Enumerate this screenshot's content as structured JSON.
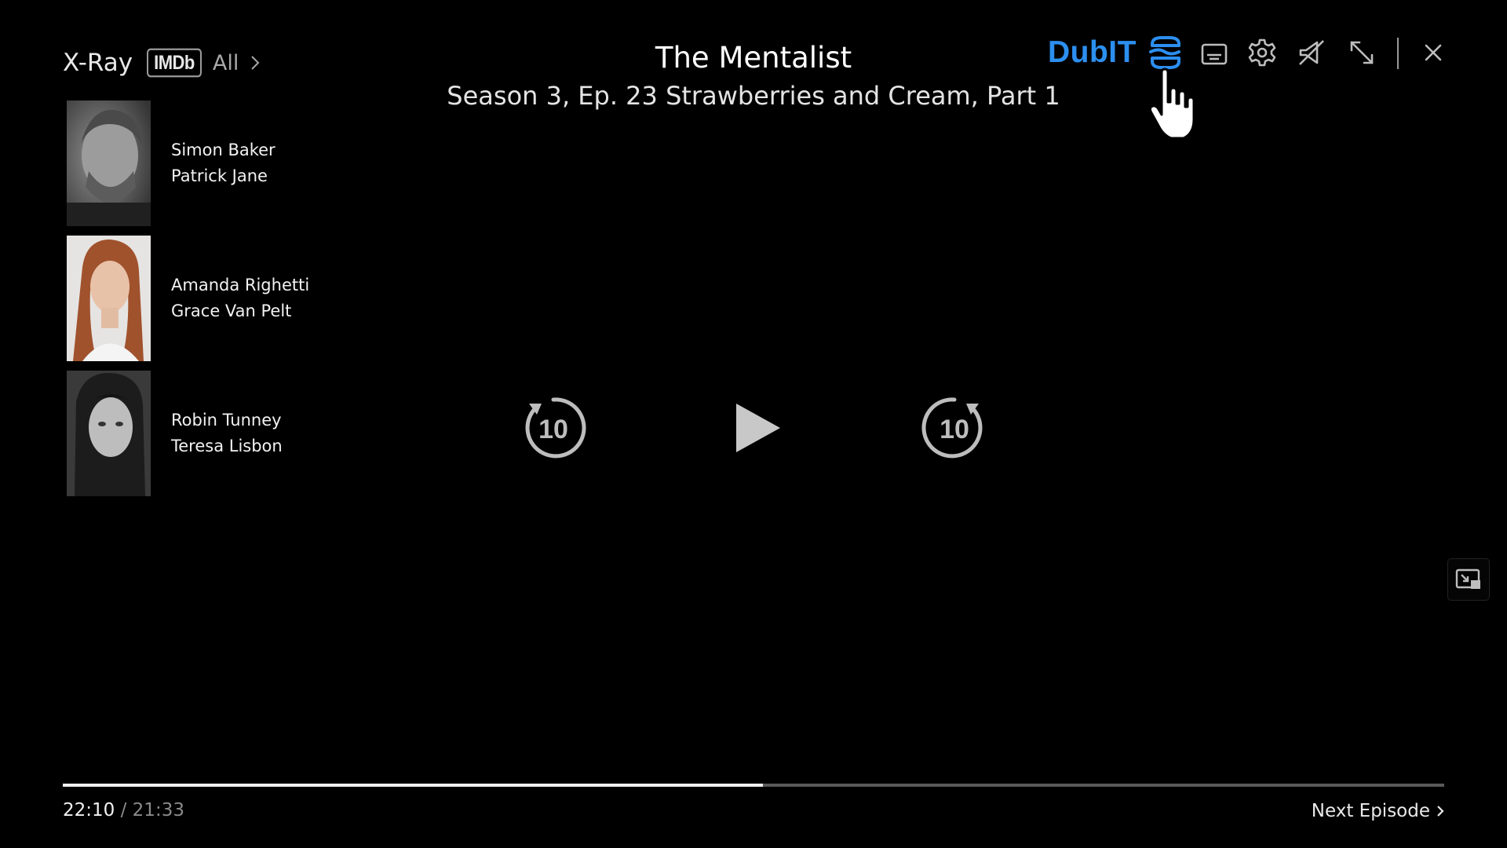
{
  "xray": {
    "title": "X-Ray",
    "imdb_badge": "IMDb",
    "all_label": "All"
  },
  "cast": [
    {
      "actor": "Simon Baker",
      "character": "Patrick Jane"
    },
    {
      "actor": "Amanda Righetti",
      "character": "Grace Van Pelt"
    },
    {
      "actor": "Robin Tunney",
      "character": "Teresa Lisbon"
    }
  ],
  "player": {
    "show_title": "The Mentalist",
    "episode_title": "Season 3, Ep. 23 Strawberries and Cream, Part 1",
    "rewind_label": "10",
    "forward_label": "10",
    "current_time": "22:10",
    "separator": " / ",
    "duration": "21:33",
    "next_episode_label": "Next Episode",
    "progress_fraction": 0.507
  },
  "toolbar": {
    "dubit_label": "DubIT",
    "icons": [
      "dubit-logo-icon",
      "subtitles-icon",
      "gear-icon",
      "cast-off-icon",
      "collapse-icon",
      "close-icon"
    ]
  },
  "colors": {
    "accent": "#2c8ff0",
    "background": "#000000"
  }
}
